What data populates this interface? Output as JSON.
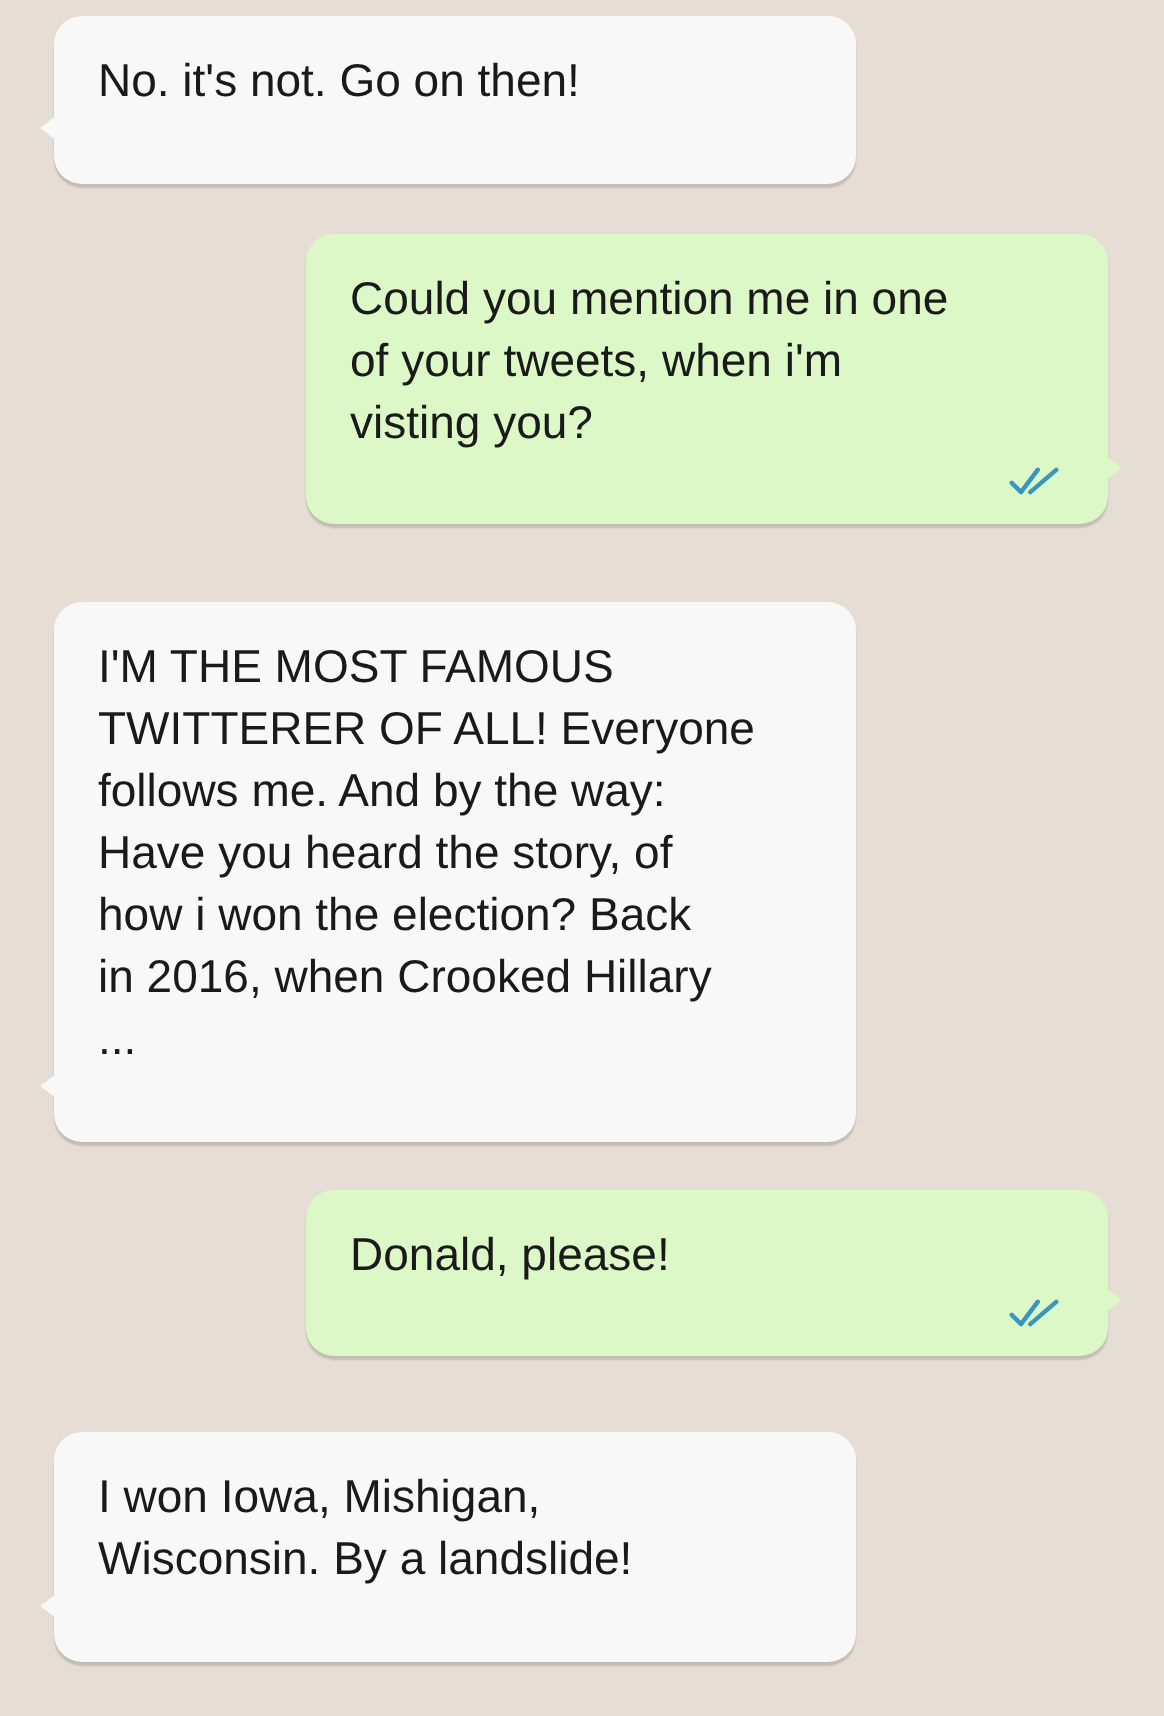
{
  "messages": [
    {
      "kind": "incoming",
      "text": "No. it's not. Go on then!"
    },
    {
      "kind": "outgoing",
      "text": "Could you mention me in one\nof your tweets, when i'm\nvisting you?",
      "read": true
    },
    {
      "kind": "incoming",
      "text": "I'M THE MOST FAMOUS\nTWITTERER OF ALL! Everyone\nfollows me. And by the way:\nHave you heard the story, of\nhow i won the election? Back\nin 2016, when Crooked Hillary\n..."
    },
    {
      "kind": "outgoing",
      "text": "Donald, please!",
      "read": true
    },
    {
      "kind": "incoming",
      "text": "I won Iowa, Mishigan,\nWisconsin. By a landslide!"
    }
  ]
}
